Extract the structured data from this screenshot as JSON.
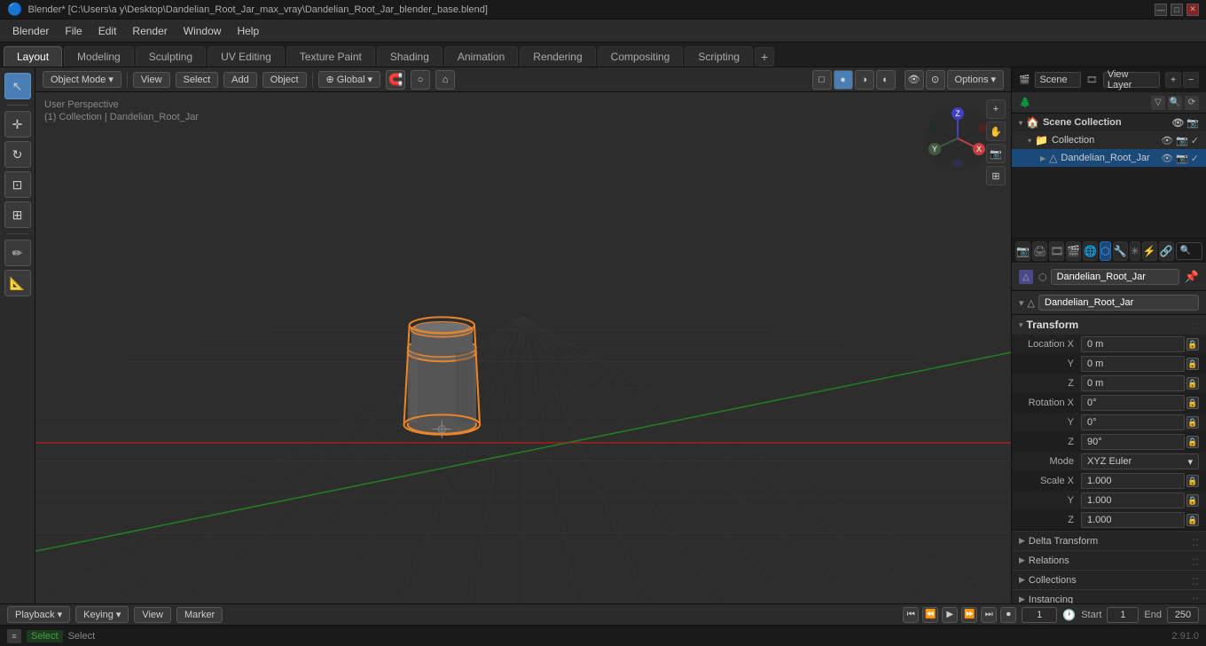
{
  "title": {
    "text": "Blender* [C:\\Users\\a y\\Desktop\\Dandelian_Root_Jar_max_vray\\Dandelian_Root_Jar_blender_base.blend]",
    "controls": [
      "—",
      "□",
      "✕"
    ]
  },
  "menu": {
    "items": [
      "Blender",
      "File",
      "Edit",
      "Render",
      "Window",
      "Help"
    ]
  },
  "workspace_tabs": {
    "tabs": [
      "Layout",
      "Modeling",
      "Sculpting",
      "UV Editing",
      "Texture Paint",
      "Shading",
      "Animation",
      "Rendering",
      "Compositing",
      "Scripting"
    ],
    "active": "Layout",
    "plus": "+"
  },
  "viewport_header": {
    "mode": "Object Mode",
    "view_label": "View",
    "select_label": "Select",
    "add_label": "Add",
    "object_label": "Object",
    "global_label": "Global",
    "shading_modes": [
      "▣",
      "◻",
      "●",
      "◑"
    ],
    "options_label": "Options",
    "snap_magnet": "🧲",
    "proportional": "○",
    "snap_settings": "≡"
  },
  "viewport": {
    "info_line1": "User Perspective",
    "info_line2": "(1) Collection | Dandelian_Root_Jar",
    "overlay_icons": [
      "🔵",
      "🔴",
      "🟢"
    ]
  },
  "right_scene": {
    "scene_label": "Scene",
    "view_layer_label": "View Layer",
    "scene_name": "Scene",
    "view_layer_name": "View Layer"
  },
  "outliner": {
    "title": "Scene Collection",
    "items": [
      {
        "name": "Collection",
        "indent": 1,
        "expanded": true,
        "icon": "📁",
        "controls": [
          "👁",
          "📷",
          "✓"
        ]
      },
      {
        "name": "Dandelian_Root_Jar",
        "indent": 2,
        "expanded": false,
        "icon": "△",
        "selected": true,
        "controls": [
          "👁",
          "📷",
          "✓"
        ]
      }
    ]
  },
  "properties": {
    "search_placeholder": "Search",
    "object_name": "Dandelian_Root_Jar",
    "object_data_name": "Dandelian_Root_Jar",
    "tabs": [
      "🎬",
      "🎞",
      "📷",
      "📐",
      "🔧",
      "⬡",
      "👤",
      "💡",
      "🌊",
      "⚙"
    ],
    "active_tab": 4,
    "sections": {
      "transform": {
        "label": "Transform",
        "location": {
          "x": "0 m",
          "y": "0 m",
          "z": "0 m"
        },
        "rotation": {
          "x": "0°",
          "y": "0°",
          "z": "90°"
        },
        "mode": "XYZ Euler",
        "scale": {
          "x": "1.000",
          "y": "1.000",
          "z": "1.000"
        }
      }
    },
    "collapsible": [
      {
        "label": "Delta Transform"
      },
      {
        "label": "Relations"
      },
      {
        "label": "Collections"
      },
      {
        "label": "Instancing"
      }
    ]
  },
  "bottom_bar": {
    "playback_label": "Playback",
    "keying_label": "Keying",
    "view_label": "View",
    "marker_label": "Marker",
    "frame_current": "1",
    "frame_start_label": "Start",
    "frame_start": "1",
    "frame_end_label": "End",
    "frame_end": "250",
    "timeline_buttons": [
      "⏮",
      "⏪",
      "▶",
      "⏩",
      "⏭",
      "⏺"
    ],
    "clock_icon": "🕐"
  },
  "status_bar": {
    "select_key": "Select",
    "version": "2.91.0"
  },
  "colors": {
    "active_blue": "#4a7fb5",
    "selected_orange": "#e8842a",
    "grid_dark": "#2d2d2d",
    "grid_line": "#3a3a3a",
    "x_axis": "#a02020",
    "y_axis": "#207020"
  }
}
